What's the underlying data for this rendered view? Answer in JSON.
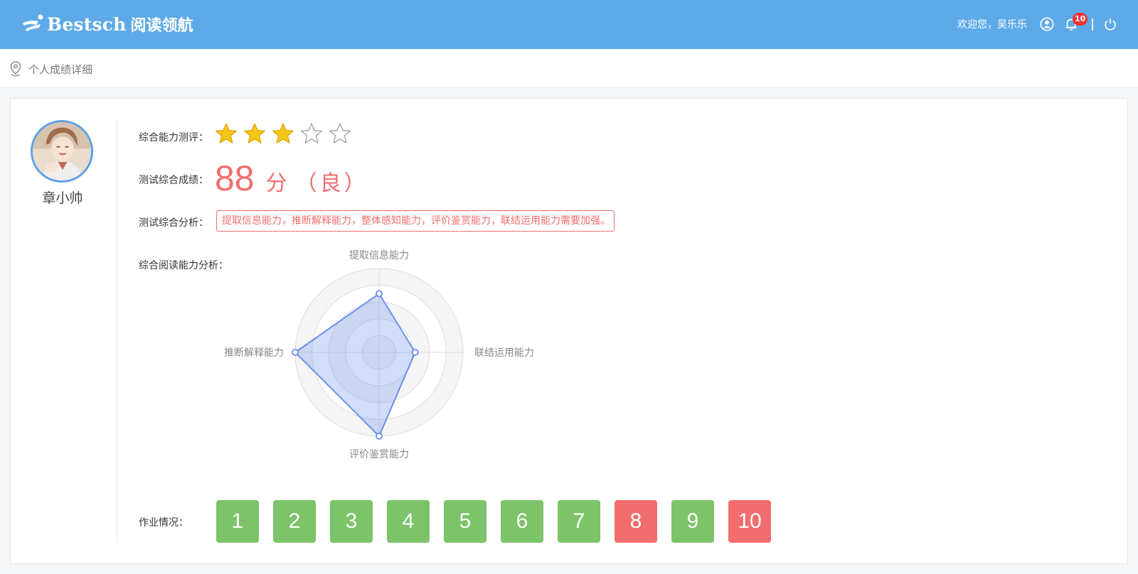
{
  "header": {
    "brand_name": "Bestsch",
    "brand_sub": "阅读领航",
    "welcome": "欢迎您，吴乐乐",
    "notification_count": "10",
    "icons": [
      "user-circle-icon",
      "bell-icon",
      "power-icon"
    ]
  },
  "breadcrumb": {
    "icon": "location-pin-icon",
    "text": "个人成绩详细"
  },
  "student": {
    "name": "章小帅",
    "avatar": "avatar"
  },
  "report": {
    "rating_label": "综合能力测评：",
    "stars_filled": 3,
    "stars_total": 5,
    "score_label": "测试综合成绩：",
    "score": "88",
    "score_unit": "分",
    "grade": "（良）",
    "analysis_label": "测试综合分析：",
    "analysis_text": "提取信息能力，推断解释能力，整体感知能力，评价鉴赏能力，联结运用能力需要加强。",
    "radar_label": "综合阅读能力分析：",
    "homework_label": "作业情况："
  },
  "chart_data": {
    "type": "radar",
    "indicators": [
      "提取信息能力",
      "联结运用能力",
      "评价鉴赏能力",
      "推断解释能力"
    ],
    "max": 100,
    "values": [
      70,
      43,
      100,
      100
    ],
    "colors": {
      "line": "#6b8ff0",
      "fill": "rgba(107,143,240,0.30)",
      "split": "#f5f5f5"
    }
  },
  "homework": [
    {
      "label": "1",
      "status": "ok"
    },
    {
      "label": "2",
      "status": "ok"
    },
    {
      "label": "3",
      "status": "ok"
    },
    {
      "label": "4",
      "status": "ok"
    },
    {
      "label": "5",
      "status": "ok"
    },
    {
      "label": "6",
      "status": "ok"
    },
    {
      "label": "7",
      "status": "ok"
    },
    {
      "label": "8",
      "status": "bad"
    },
    {
      "label": "9",
      "status": "ok"
    },
    {
      "label": "10",
      "status": "bad"
    }
  ],
  "colors": {
    "header": "#5eaae8",
    "accent_red": "#f26d6d",
    "ok_green": "#7cc36a",
    "star_gold": "#f5c518"
  }
}
